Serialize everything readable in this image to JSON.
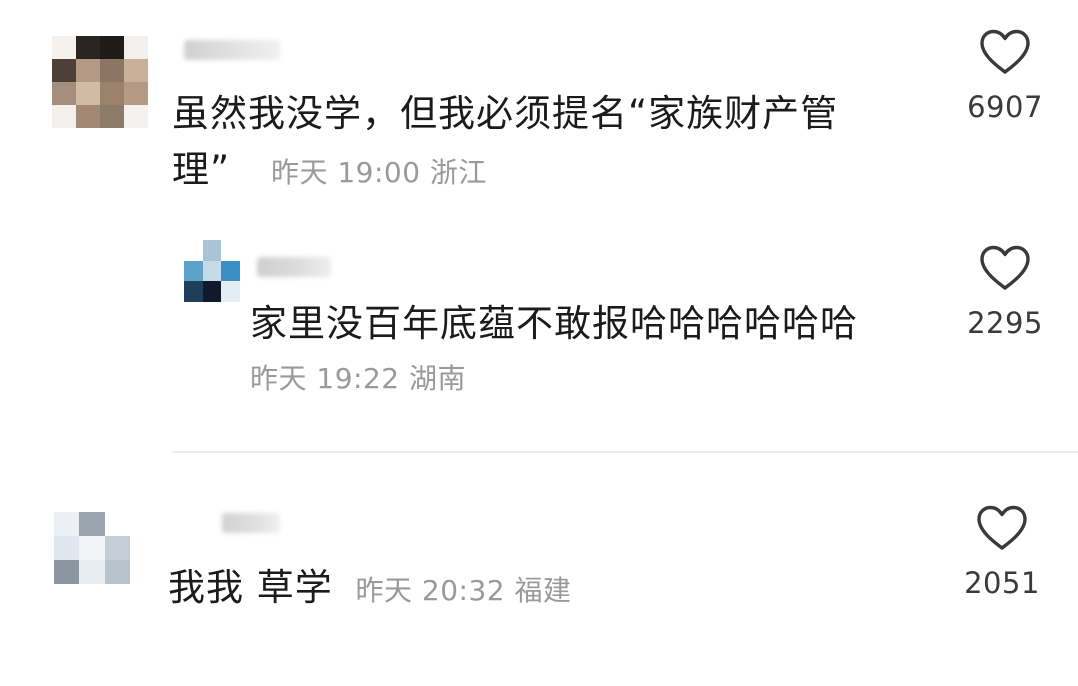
{
  "comments": [
    {
      "text": "虽然我没学，但我必须提名“家族财产管理”",
      "meta": "昨天 19:00 浙江",
      "likes": "6907",
      "reply": {
        "text": "家里没百年底蕴不敢报哈哈哈哈哈哈",
        "meta": "昨天 19:22 湖南",
        "likes": "2295"
      }
    },
    {
      "text": "我我 草学",
      "meta": "昨天 20:32 福建",
      "likes": "2051"
    }
  ],
  "icons": {
    "like": "heart-outline-icon"
  },
  "colors": {
    "text": "#1b1b1b",
    "meta": "#9a9a9a",
    "icon": "#3a3a3a",
    "divider": "#ededed"
  }
}
